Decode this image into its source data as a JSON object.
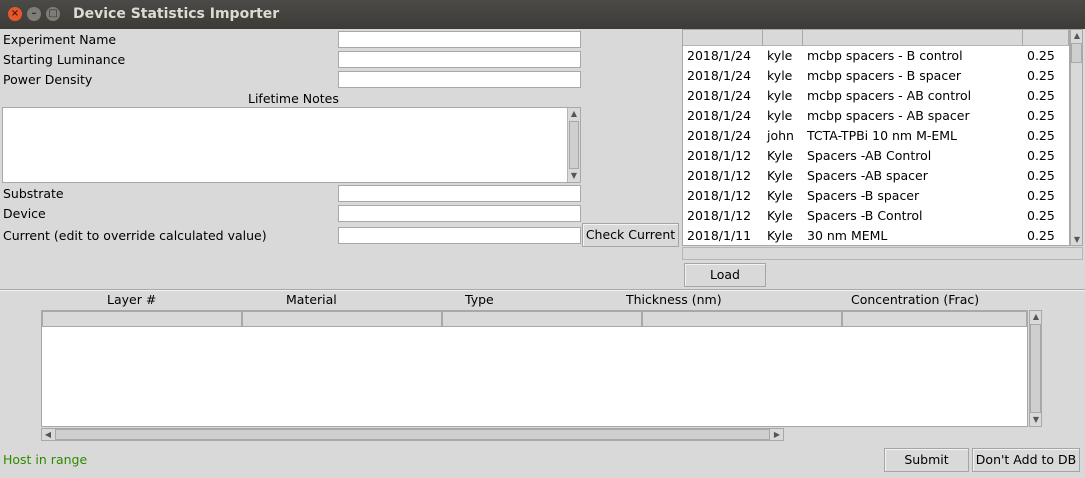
{
  "window": {
    "title": "Device Statistics Importer",
    "close_glyph": "×",
    "minimize_glyph": "–",
    "maximize_glyph": "□"
  },
  "form": {
    "experiment_name": {
      "label": "Experiment Name",
      "value": ""
    },
    "starting_luminance": {
      "label": "Starting Luminance",
      "value": ""
    },
    "power_density": {
      "label": "Power Density",
      "value": ""
    },
    "lifetime_notes": {
      "label": "Lifetime Notes",
      "value": ""
    },
    "substrate": {
      "label": "Substrate",
      "value": ""
    },
    "device": {
      "label": "Device",
      "value": ""
    },
    "current": {
      "label": "Current (edit to override calculated value)",
      "value": ""
    },
    "check_current_button": "Check Current"
  },
  "experiments": {
    "rows": [
      {
        "date": "2018/1/24",
        "user": "kyle",
        "name": "mcbp spacers - B control",
        "value": "0.25"
      },
      {
        "date": "2018/1/24",
        "user": "kyle",
        "name": "mcbp spacers - B spacer",
        "value": "0.25"
      },
      {
        "date": "2018/1/24",
        "user": "kyle",
        "name": "mcbp spacers - AB control",
        "value": "0.25"
      },
      {
        "date": "2018/1/24",
        "user": "kyle",
        "name": "mcbp spacers - AB spacer",
        "value": "0.25"
      },
      {
        "date": "2018/1/24",
        "user": "john",
        "name": "TCTA-TPBi 10 nm M-EML",
        "value": "0.25"
      },
      {
        "date": "2018/1/12",
        "user": "Kyle",
        "name": "Spacers -AB Control",
        "value": "0.25"
      },
      {
        "date": "2018/1/12",
        "user": "Kyle",
        "name": "Spacers -AB spacer",
        "value": "0.25"
      },
      {
        "date": "2018/1/12",
        "user": "Kyle",
        "name": "Spacers -B spacer",
        "value": "0.25"
      },
      {
        "date": "2018/1/12",
        "user": "Kyle",
        "name": "Spacers -B Control",
        "value": "0.25"
      },
      {
        "date": "2018/1/11",
        "user": "Kyle",
        "name": "30 nm MEML",
        "value": "0.25"
      }
    ],
    "load_button": "Load"
  },
  "layers": {
    "columns": [
      "Layer #",
      "Material",
      "Type",
      "Thickness (nm)",
      "Concentration (Frac)"
    ]
  },
  "footer": {
    "status": "Host in range",
    "status_color": "#2e8b00",
    "submit_button": "Submit",
    "dont_add_button": "Don't Add to DB"
  },
  "icons": {
    "up_arrow": "▲",
    "down_arrow": "▼",
    "left_arrow": "◀",
    "right_arrow": "▶"
  }
}
